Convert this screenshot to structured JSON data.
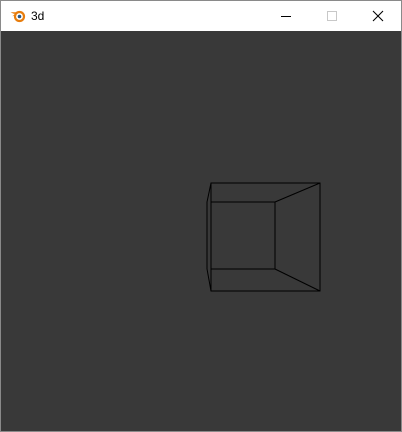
{
  "window": {
    "title": "3d",
    "controls": {
      "minimize": "minimize-icon",
      "maximize": "maximize-icon",
      "close": "close-icon"
    }
  },
  "viewport": {
    "background": "#393939",
    "line_color": "#000000",
    "object": "wireframe-cube"
  },
  "colors": {
    "titlebar": "#ffffff",
    "title_text": "#000000",
    "icon_brand": "#e87d0d",
    "disabled_control": "#c8c8c8"
  }
}
